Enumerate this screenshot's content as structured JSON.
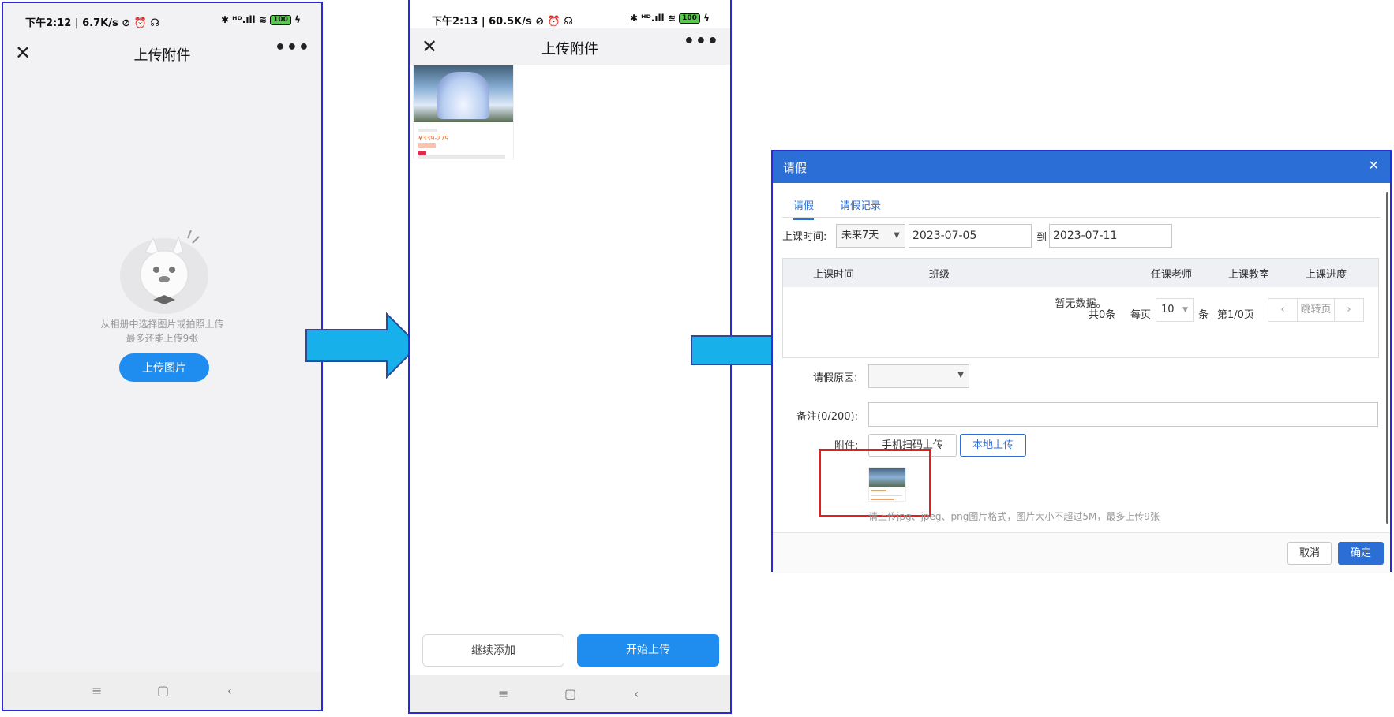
{
  "phone1": {
    "status_left": "下午2:12 | 6.7K/s ⊘ ⏰ ☊",
    "status_right": "✱ ᴴᴰ.ıll ≋",
    "battery": "100",
    "title": "上传附件",
    "close": "✕",
    "more": "•••",
    "empty_line1": "从相册中选择图片或拍照上传",
    "empty_line2": "最多还能上传9张",
    "upload_button": "上传图片"
  },
  "phone2": {
    "status_left": "下午2:13 | 60.5K/s ⊘ ⏰ ☊",
    "status_right": "✱ ᴴᴰ.ıll ≋",
    "battery": "100",
    "title": "上传附件",
    "close": "✕",
    "more": "•••",
    "thumb_price": "¥339-279",
    "continue_button": "继续添加",
    "start_button": "开始上传"
  },
  "nav_keys": {
    "menu": "≡",
    "home": "▢",
    "back": "‹"
  },
  "dialog": {
    "title": "请假",
    "close": "✕",
    "tabs": [
      "请假",
      "请假记录"
    ],
    "class_time_label": "上课时间:",
    "range_select": "未来7天",
    "date_from": "2023-07-05",
    "to_label": "到",
    "date_to": "2023-07-11",
    "columns": [
      "上课时间",
      "班级",
      "任课老师",
      "上课教室",
      "上课进度"
    ],
    "empty_text": "暂无数据。",
    "pager": {
      "total": "共0条",
      "per_page": "每页",
      "page_size": "10",
      "unit": "条",
      "page_info": "第1/0页",
      "prev": "‹",
      "jump": "跳转页",
      "next": "›"
    },
    "reason_label": "请假原因:",
    "remark_label": "备注(0/200):",
    "attach_label": "附件:",
    "scan_upload": "手机扫码上传",
    "local_upload": "本地上传",
    "hint": "请上传jpg、jpeg、png图片格式，图片大小不超过5M，最多上传9张",
    "cancel": "取消",
    "confirm": "确定"
  },
  "colors": {
    "primary_blue": "#1f8df0",
    "dialog_blue": "#2b6fd6",
    "arrow_fill": "#17b0ea",
    "highlight_red": "#e02020"
  }
}
